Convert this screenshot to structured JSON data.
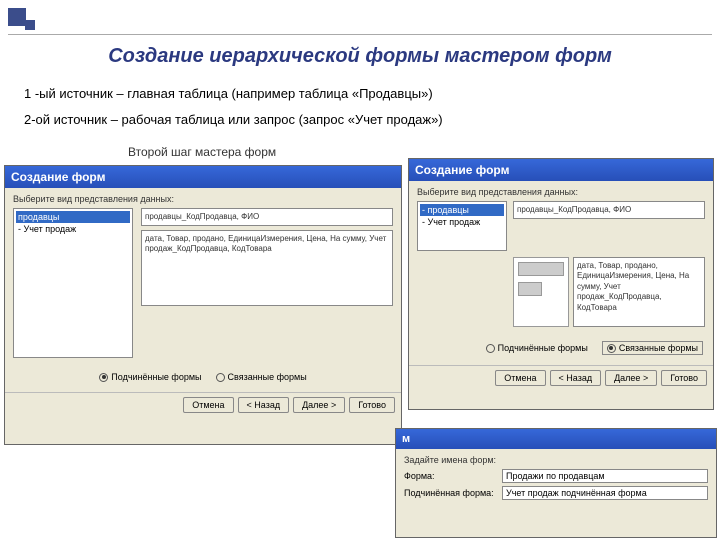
{
  "header": {
    "title": "Создание иерархической формы мастером форм",
    "line1": "1 -ый источник – главная таблица (например таблица «Продавцы»)",
    "line2": "2-ой источник – рабочая таблица или запрос (запрос «Учет продаж»)",
    "caption": "Второй шаг мастера форм"
  },
  "dlgA": {
    "title": "Создание форм",
    "prompt": "Выберите вид представления данных:",
    "list": [
      "продавцы",
      "- Учет продаж"
    ],
    "fields1": "продавцы_КодПродавца, ФИО",
    "fields2": "дата, Товар, продано, ЕдиницаИзмерения, Цена, На сумму, Учет продаж_КодПродавца, КодТовара",
    "radio1": "Подчинённые формы",
    "radio2": "Связанные формы",
    "btn_cancel": "Отмена",
    "btn_back": "< Назад",
    "btn_next": "Далее >",
    "btn_done": "Готово"
  },
  "dlgB": {
    "title": "Создание форм",
    "prompt": "Выберите вид представления данных:",
    "list": [
      "- продавцы",
      "- Учет продаж"
    ],
    "fields1": "продавцы_КодПродавца, ФИО",
    "fields2": "дата, Товар, продано, ЕдиницаИзмерения, Цена, На сумму, Учет продаж_КодПродавца, КодТовара",
    "radio1": "Подчинённые формы",
    "radio2": "Связанные формы",
    "btn_cancel": "Отмена",
    "btn_back": "< Назад",
    "btn_next": "Далее >",
    "btn_done": "Готово"
  },
  "dlgC": {
    "titlechar": "м",
    "prompt": "Задайте имена форм:",
    "lbl1": "Форма:",
    "val1": "Продажи по продавцам",
    "lbl2": "Подчинённая форма:",
    "val2": "Учет продаж подчинённая форма"
  }
}
